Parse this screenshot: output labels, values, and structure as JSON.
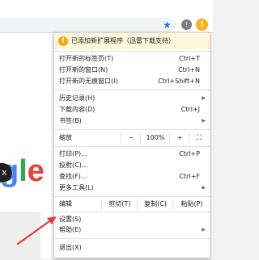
{
  "browser": {
    "extension_icon_text": "!",
    "avatar_text": "!"
  },
  "page": {
    "logo_letters": [
      "g",
      "l",
      "e"
    ],
    "dark_button_text": "x"
  },
  "menu": {
    "notice": {
      "icon_text": "!",
      "text": "已添加新扩展程序（迅雷下载支持）"
    },
    "group1": [
      {
        "label": "打开新的标签页(T)",
        "shortcut": "Ctrl+T"
      },
      {
        "label": "打开新的窗口(N)",
        "shortcut": "Ctrl+N"
      },
      {
        "label": "打开新的无痕窗口(I)",
        "shortcut": "Ctrl+Shift+N"
      }
    ],
    "group2": [
      {
        "label": "历史记录(H)",
        "shortcut": "",
        "submenu": true
      },
      {
        "label": "下载内容(D)",
        "shortcut": "Ctrl+J"
      },
      {
        "label": "书签(B)",
        "shortcut": "",
        "submenu": true
      }
    ],
    "zoom": {
      "label": "缩放",
      "minus": "−",
      "value": "100%",
      "plus": "+",
      "fullscreen": "⛶"
    },
    "group3": [
      {
        "label": "打印(P)...",
        "shortcut": "Ctrl+P"
      },
      {
        "label": "投射(C)...",
        "shortcut": ""
      },
      {
        "label": "查找(F)...",
        "shortcut": "Ctrl+F"
      },
      {
        "label": "更多工具(L)",
        "shortcut": "",
        "submenu": true
      }
    ],
    "edit": {
      "label": "编辑",
      "cut": "剪切(T)",
      "copy": "复制(C)",
      "paste": "粘贴(P)"
    },
    "group4": [
      {
        "label": "设置(S)",
        "shortcut": ""
      },
      {
        "label": "帮助(E)",
        "shortcut": "",
        "submenu": true
      }
    ],
    "exit": {
      "label": "退出(X)"
    }
  },
  "colors": {
    "annotation_arrow": "#e53935",
    "notice_bg": "#fdf6d8",
    "accent": "#1a73e8"
  }
}
